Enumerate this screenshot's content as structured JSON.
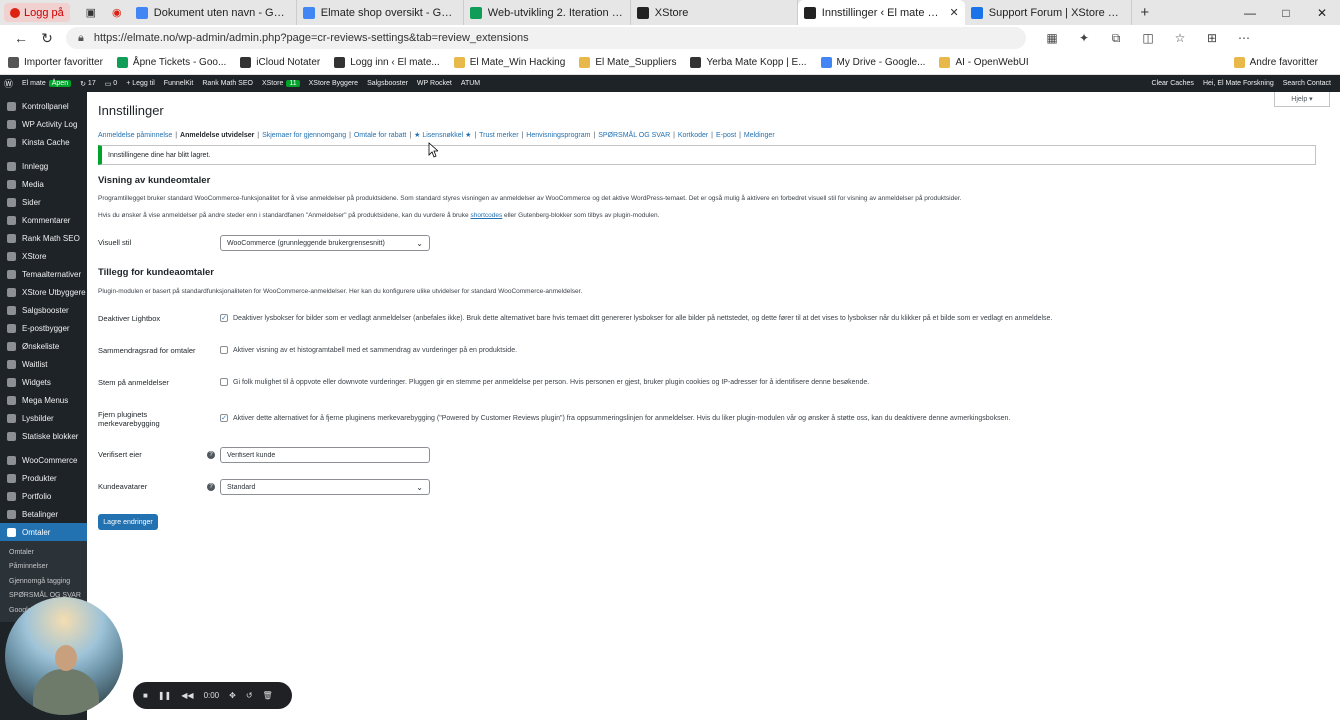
{
  "browser": {
    "profile_label": "Logg på",
    "tabs": [
      {
        "title": "Dokument uten navn - Google Dokumenter",
        "color": "#4285f4"
      },
      {
        "title": "Elmate shop oversikt - Google Dokumenter",
        "color": "#4285f4"
      },
      {
        "title": "Web-utvikling 2. Iteration - Google",
        "color": "#0f9d58"
      },
      {
        "title": "XStore",
        "color": "#222222"
      },
      {
        "title": "Innstillinger ‹ El mate — WordPress",
        "color": "#222222",
        "active": true
      },
      {
        "title": "Support Forum | XStore WordPress",
        "color": "#1a73e8"
      }
    ],
    "url": "https://elmate.no/wp-admin/admin.php?page=cr-reviews-settings&tab=review_extensions",
    "bookmarks": [
      {
        "label": "Importer favoritter",
        "color": "#555555"
      },
      {
        "label": "Åpne Tickets - Goo...",
        "color": "#0f9d58"
      },
      {
        "label": "iCloud Notater",
        "color": "#333333"
      },
      {
        "label": "Logg inn ‹ El mate...",
        "color": "#333333"
      },
      {
        "label": "El Mate_Win Hacking",
        "color": "#e8b84a"
      },
      {
        "label": "El Mate_Suppliers",
        "color": "#e8b84a"
      },
      {
        "label": "Yerba Mate Kopp | E...",
        "color": "#333333"
      },
      {
        "label": "My Drive - Google...",
        "color": "#4285f4"
      },
      {
        "label": "AI - OpenWebUI",
        "color": "#e8b84a"
      }
    ],
    "bookmarks_right": "Andre favoritter"
  },
  "adminbar": {
    "items": [
      "El mate",
      "17",
      "0",
      "+ Legg til",
      "FunnelKit",
      "Rank Math SEO",
      "XStore",
      "XStore Byggere",
      "Salgsbooster",
      "WP Rocket",
      "ATUM"
    ],
    "open_pill": "Åpen",
    "xstore_pill": "11",
    "clear_caches": "Clear Caches",
    "greeting": "Hei, El Mate Forskning",
    "search_contact": "Search Contact"
  },
  "sidebar": {
    "items": [
      {
        "label": "Kontrollpanel"
      },
      {
        "label": "WP Activity Log"
      },
      {
        "label": "Kinsta Cache"
      },
      {
        "sep": true
      },
      {
        "label": "Innlegg"
      },
      {
        "label": "Media"
      },
      {
        "label": "Sider"
      },
      {
        "label": "Kommentarer"
      },
      {
        "label": "Rank Math SEO"
      },
      {
        "label": "XStore"
      },
      {
        "label": "Temaalternativer"
      },
      {
        "label": "XStore Utbyggere"
      },
      {
        "label": "Salgsbooster"
      },
      {
        "label": "E-postbygger"
      },
      {
        "label": "Ønskeliste"
      },
      {
        "label": "Waitlist"
      },
      {
        "label": "Widgets"
      },
      {
        "label": "Mega Menus"
      },
      {
        "label": "Lysbilder"
      },
      {
        "label": "Statiske blokker"
      },
      {
        "sep": true
      },
      {
        "label": "WooCommerce"
      },
      {
        "label": "Produkter"
      },
      {
        "label": "Portfolio"
      },
      {
        "label": "Betalinger"
      },
      {
        "label": "Omtaler",
        "active": true
      }
    ],
    "submenu": [
      "Omtaler",
      "Påminnelser",
      "Gjennomgå tagging",
      "SPØRSMÅL OG SVAR",
      "Google"
    ]
  },
  "page": {
    "help": "Hjelp ▾",
    "title": "Innstillinger",
    "subnav": [
      {
        "label": "Anmeldelse påminnelse"
      },
      {
        "label": "Anmeldelse utvidelser",
        "current": true
      },
      {
        "label": "Skjemaer for gjennomgang"
      },
      {
        "label": "Omtale for rabatt"
      },
      {
        "label": "★ Lisensnøkkel ★"
      },
      {
        "label": "Trust merker"
      },
      {
        "label": "Henvisningsprogram"
      },
      {
        "label": "SPØRSMÅL OG SVAR"
      },
      {
        "label": "Kortkoder"
      },
      {
        "label": "E-post"
      },
      {
        "label": "Meldinger"
      }
    ],
    "notice": "Innstillingene dine har blitt lagret.",
    "section1": {
      "title": "Visning av kundeomtaler",
      "desc1": "Programtillegget bruker standard WooCommerce-funksjonalitet for å vise anmeldelser på produktsidene. Som standard styres visningen av anmeldelser av WooCommerce og det aktive WordPress-temaet. Det er også mulig å aktivere en forbedret visuell stil for visning av anmeldelser på produktsider.",
      "desc2_a": "Hvis du ønsker å vise anmeldelser på andre steder enn i standardfanen \"Anmeldelser\" på produktsidene, kan du vurdere å bruke ",
      "desc2_link": "shortcodes",
      "desc2_b": " eller Gutenberg-blokker som tilbys av plugin-modulen.",
      "visual_label": "Visuell stil",
      "visual_value": "WooCommerce (grunnleggende brukergrensesnitt)"
    },
    "section2": {
      "title": "Tillegg for kundeaomtaler",
      "desc": "Plugin-modulen er basert på standardfunksjonaliteten for WooCommerce-anmeldelser. Her kan du konfigurere ulike utvidelser for standard WooCommerce-anmeldelser.",
      "rows": [
        {
          "label": "Deaktiver Lightbox",
          "checked": true,
          "text": "Deaktiver lysbokser for bilder som er vedlagt anmeldelser (anbefales ikke). Bruk dette alternativet bare hvis temaet ditt genererer lysbokser for alle bilder på nettstedet, og dette fører til at det vises to lysbokser når du klikker på et bilde som er vedlagt en anmeldelse."
        },
        {
          "label": "Sammendragsrad for omtaler",
          "checked": false,
          "text": "Aktiver visning av et histogramtabell med et sammendrag av vurderinger på en produktside."
        },
        {
          "label": "Stem på anmeldelser",
          "checked": false,
          "text": "Gi folk mulighet til å oppvote eller downvote vurderinger. Pluggen gir en stemme per anmeldelse per person. Hvis personen er gjest, bruker plugin cookies og IP-adresser for å identifisere denne besøkende."
        },
        {
          "label1": "Fjern pluginets",
          "label2": "merkevarebygging",
          "checked": true,
          "text": "Aktiver dette alternativet for å fjerne pluginens merkevarebygging (\"Powered by Customer Reviews plugin\") fra oppsummeringslinjen for anmeldelser. Hvis du liker plugin-modulen vår og ønsker å støtte oss, kan du deaktivere denne avmerkingsboksen."
        }
      ],
      "verified_label": "Verifisert eier",
      "verified_value": "Verifisert kunde",
      "avatar_label": "Kundeavatarer",
      "avatar_value": "Standard"
    },
    "save": "Lagre endringer"
  },
  "recorder": {
    "time": "0:00"
  }
}
